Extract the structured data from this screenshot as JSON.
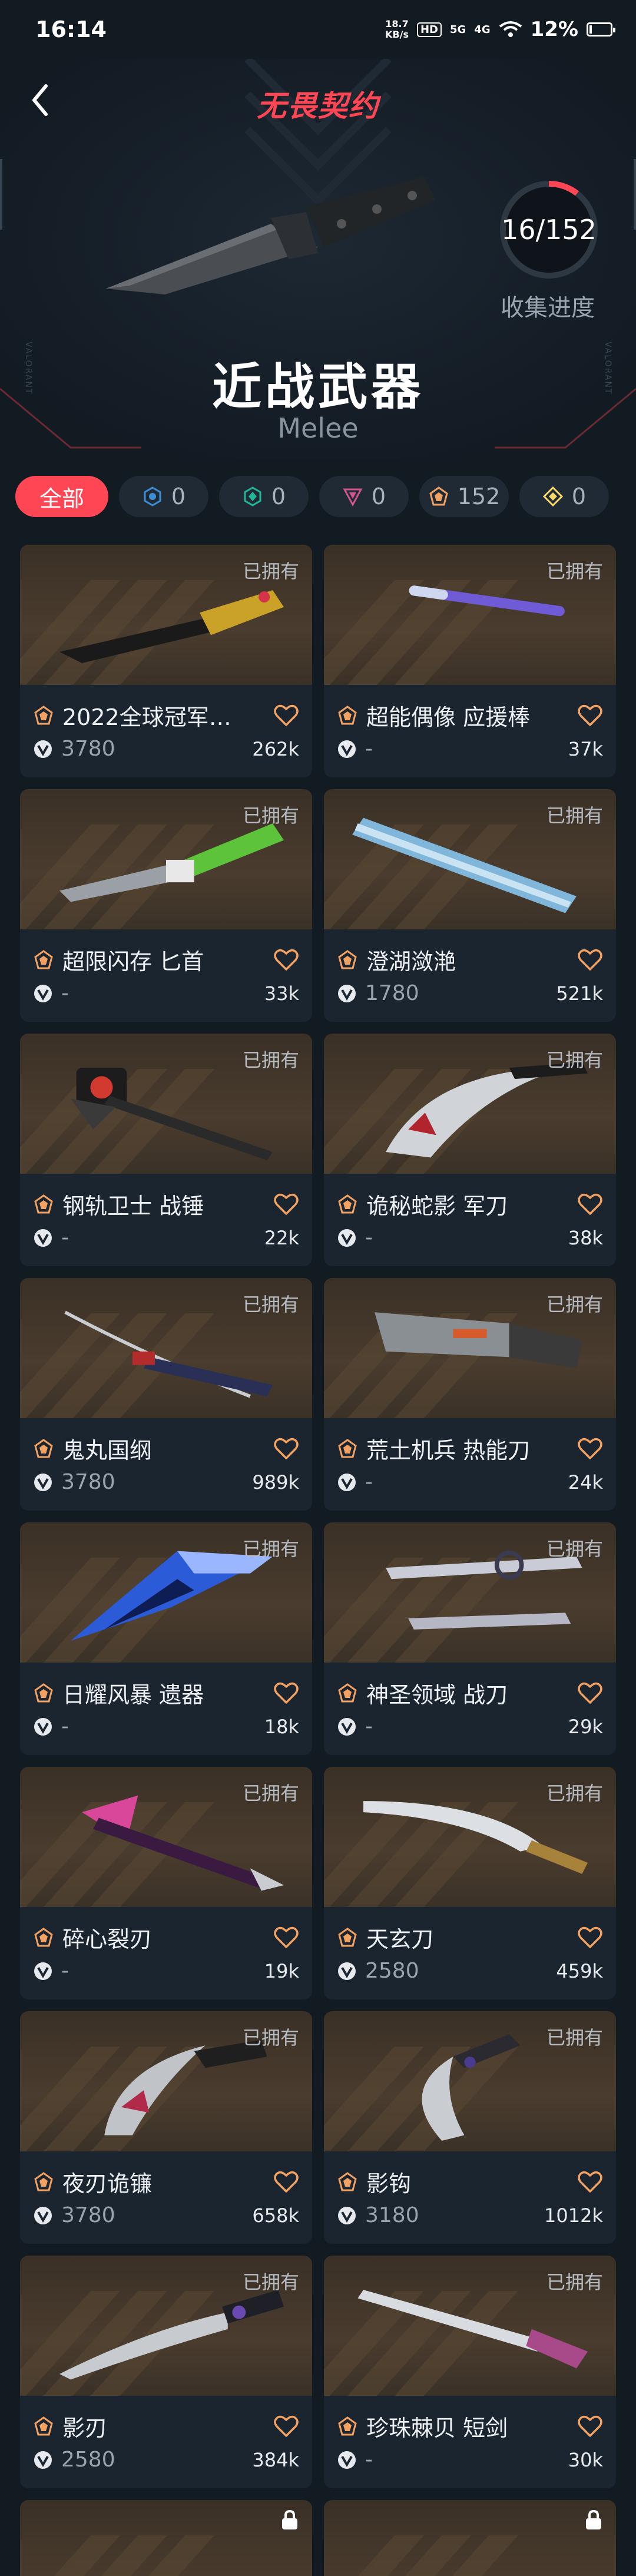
{
  "status_bar": {
    "time": "16:14",
    "speed_value": "18.7",
    "speed_unit": "KB/s",
    "hd_label": "HD",
    "network": "5G",
    "network2": "4G",
    "battery": "12%",
    "battery_level": 0.12
  },
  "header": {
    "logo": "无畏契约",
    "title": "近战武器",
    "subtitle": "Melee",
    "progress_text": "16/152",
    "progress_owned": 16,
    "progress_total": 152,
    "progress_label": "收集进度",
    "side_text": "VALORANT"
  },
  "filters": [
    {
      "label": "全部",
      "icon": "",
      "active": true
    },
    {
      "label": "0",
      "icon": "select-tier-icon",
      "color": "#3c8fd6"
    },
    {
      "label": "0",
      "icon": "deluxe-tier-icon",
      "color": "#1fb899"
    },
    {
      "label": "0",
      "icon": "premium-tier-icon",
      "color": "#d1548e"
    },
    {
      "label": "152",
      "icon": "exclusive-tier-icon",
      "color": "#f4a261"
    },
    {
      "label": "0",
      "icon": "ultra-tier-icon",
      "color": "#fad663"
    }
  ],
  "accent_color": "#ff4655",
  "cards": [
    {
      "name": "2022全球冠军…",
      "price": "3780",
      "likes": "262k",
      "owned": "已拥有"
    },
    {
      "name": "超能偶像 应援棒",
      "price": "-",
      "likes": "37k",
      "owned": "已拥有"
    },
    {
      "name": "超限闪存 匕首",
      "price": "-",
      "likes": "33k",
      "owned": "已拥有"
    },
    {
      "name": "澄湖潋滟",
      "price": "1780",
      "likes": "521k",
      "owned": "已拥有"
    },
    {
      "name": "钢轨卫士 战锤",
      "price": "-",
      "likes": "22k",
      "owned": "已拥有"
    },
    {
      "name": "诡秘蛇影 军刀",
      "price": "-",
      "likes": "38k",
      "owned": "已拥有"
    },
    {
      "name": "鬼丸国纲",
      "price": "3780",
      "likes": "989k",
      "owned": "已拥有"
    },
    {
      "name": "荒土机兵 热能刀",
      "price": "-",
      "likes": "24k",
      "owned": "已拥有"
    },
    {
      "name": "日耀风暴 遗器",
      "price": "-",
      "likes": "18k",
      "owned": "已拥有"
    },
    {
      "name": "神圣领域 战刀",
      "price": "-",
      "likes": "29k",
      "owned": "已拥有"
    },
    {
      "name": "碎心裂刃",
      "price": "-",
      "likes": "19k",
      "owned": "已拥有"
    },
    {
      "name": "天玄刀",
      "price": "2580",
      "likes": "459k",
      "owned": "已拥有"
    },
    {
      "name": "夜刃诡镰",
      "price": "3780",
      "likes": "658k",
      "owned": "已拥有"
    },
    {
      "name": "影钩",
      "price": "3180",
      "likes": "1012k",
      "owned": "已拥有"
    },
    {
      "name": "影刃",
      "price": "2580",
      "likes": "384k",
      "owned": "已拥有"
    },
    {
      "name": "珍珠棘贝 短剑",
      "price": "-",
      "likes": "30k",
      "owned": "已拥有"
    }
  ]
}
